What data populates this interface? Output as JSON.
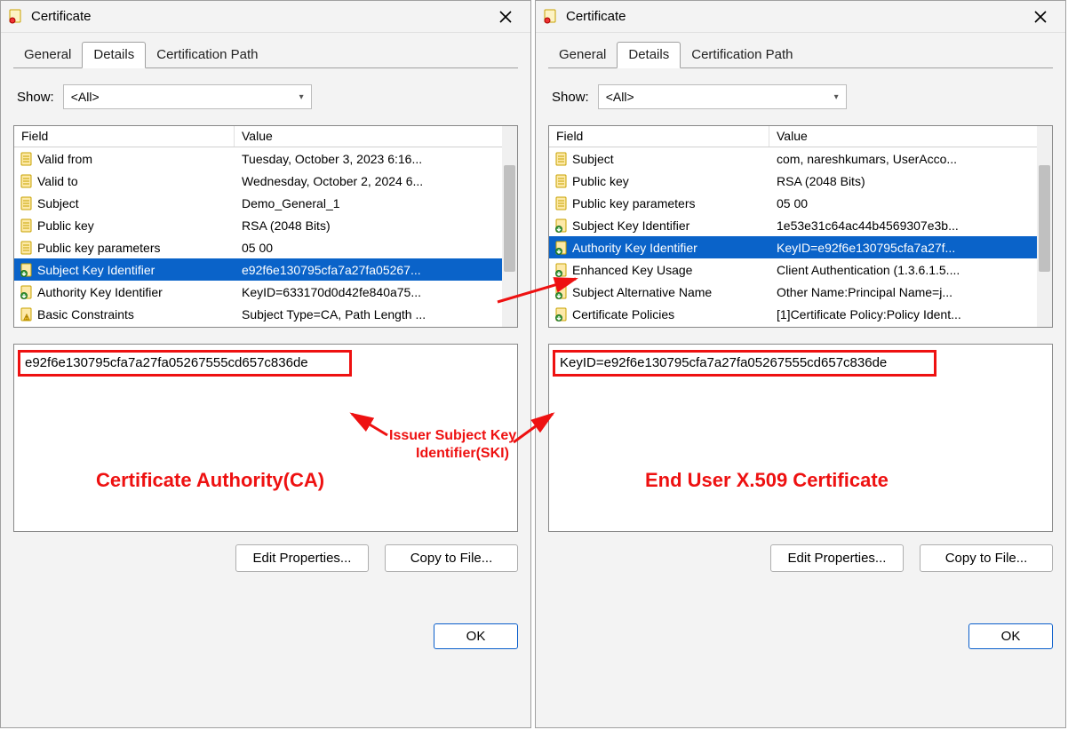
{
  "left": {
    "title": "Certificate",
    "tabs": {
      "general": "General",
      "details": "Details",
      "certpath": "Certification Path"
    },
    "show_label": "Show:",
    "show_value": "<All>",
    "columns": {
      "field": "Field",
      "value": "Value"
    },
    "rows": [
      {
        "icon": "doc",
        "field": "Valid from",
        "value": "Tuesday, October 3, 2023 6:16..."
      },
      {
        "icon": "doc",
        "field": "Valid to",
        "value": "Wednesday, October 2, 2024 6..."
      },
      {
        "icon": "doc",
        "field": "Subject",
        "value": "Demo_General_1"
      },
      {
        "icon": "doc",
        "field": "Public key",
        "value": "RSA (2048 Bits)"
      },
      {
        "icon": "doc",
        "field": "Public key parameters",
        "value": "05 00"
      },
      {
        "icon": "ext",
        "field": "Subject Key Identifier",
        "value": "e92f6e130795cfa7a27fa05267...",
        "selected": true
      },
      {
        "icon": "ext",
        "field": "Authority Key Identifier",
        "value": "KeyID=633170d0d42fe840a75..."
      },
      {
        "icon": "warn",
        "field": "Basic Constraints",
        "value": "Subject Type=CA, Path Length ..."
      }
    ],
    "detail_text": "e92f6e130795cfa7a27fa05267555cd657c836de",
    "buttons": {
      "edit": "Edit Properties...",
      "copy": "Copy to File...",
      "ok": "OK"
    },
    "annotation": "Certificate Authority(CA)"
  },
  "right": {
    "title": "Certificate",
    "tabs": {
      "general": "General",
      "details": "Details",
      "certpath": "Certification Path"
    },
    "show_label": "Show:",
    "show_value": "<All>",
    "columns": {
      "field": "Field",
      "value": "Value"
    },
    "rows": [
      {
        "icon": "doc",
        "field": "Subject",
        "value": "com, nareshkumars, UserAcco..."
      },
      {
        "icon": "doc",
        "field": "Public key",
        "value": "RSA (2048 Bits)"
      },
      {
        "icon": "doc",
        "field": "Public key parameters",
        "value": "05 00"
      },
      {
        "icon": "ext",
        "field": "Subject Key Identifier",
        "value": "1e53e31c64ac44b4569307e3b..."
      },
      {
        "icon": "ext",
        "field": "Authority Key Identifier",
        "value": "KeyID=e92f6e130795cfa7a27f...",
        "selected": true
      },
      {
        "icon": "ext",
        "field": "Enhanced Key Usage",
        "value": "Client Authentication (1.3.6.1.5...."
      },
      {
        "icon": "ext",
        "field": "Subject Alternative Name",
        "value": "Other Name:Principal Name=j..."
      },
      {
        "icon": "ext",
        "field": "Certificate Policies",
        "value": "[1]Certificate Policy:Policy Ident..."
      }
    ],
    "detail_text": "KeyID=e92f6e130795cfa7a27fa05267555cd657c836de",
    "buttons": {
      "edit": "Edit Properties...",
      "copy": "Copy to File...",
      "ok": "OK"
    },
    "annotation": "End User X.509 Certificate"
  },
  "center_annotation_line1": "Issuer Subject Key",
  "center_annotation_line2": "Identifier(SKI)"
}
